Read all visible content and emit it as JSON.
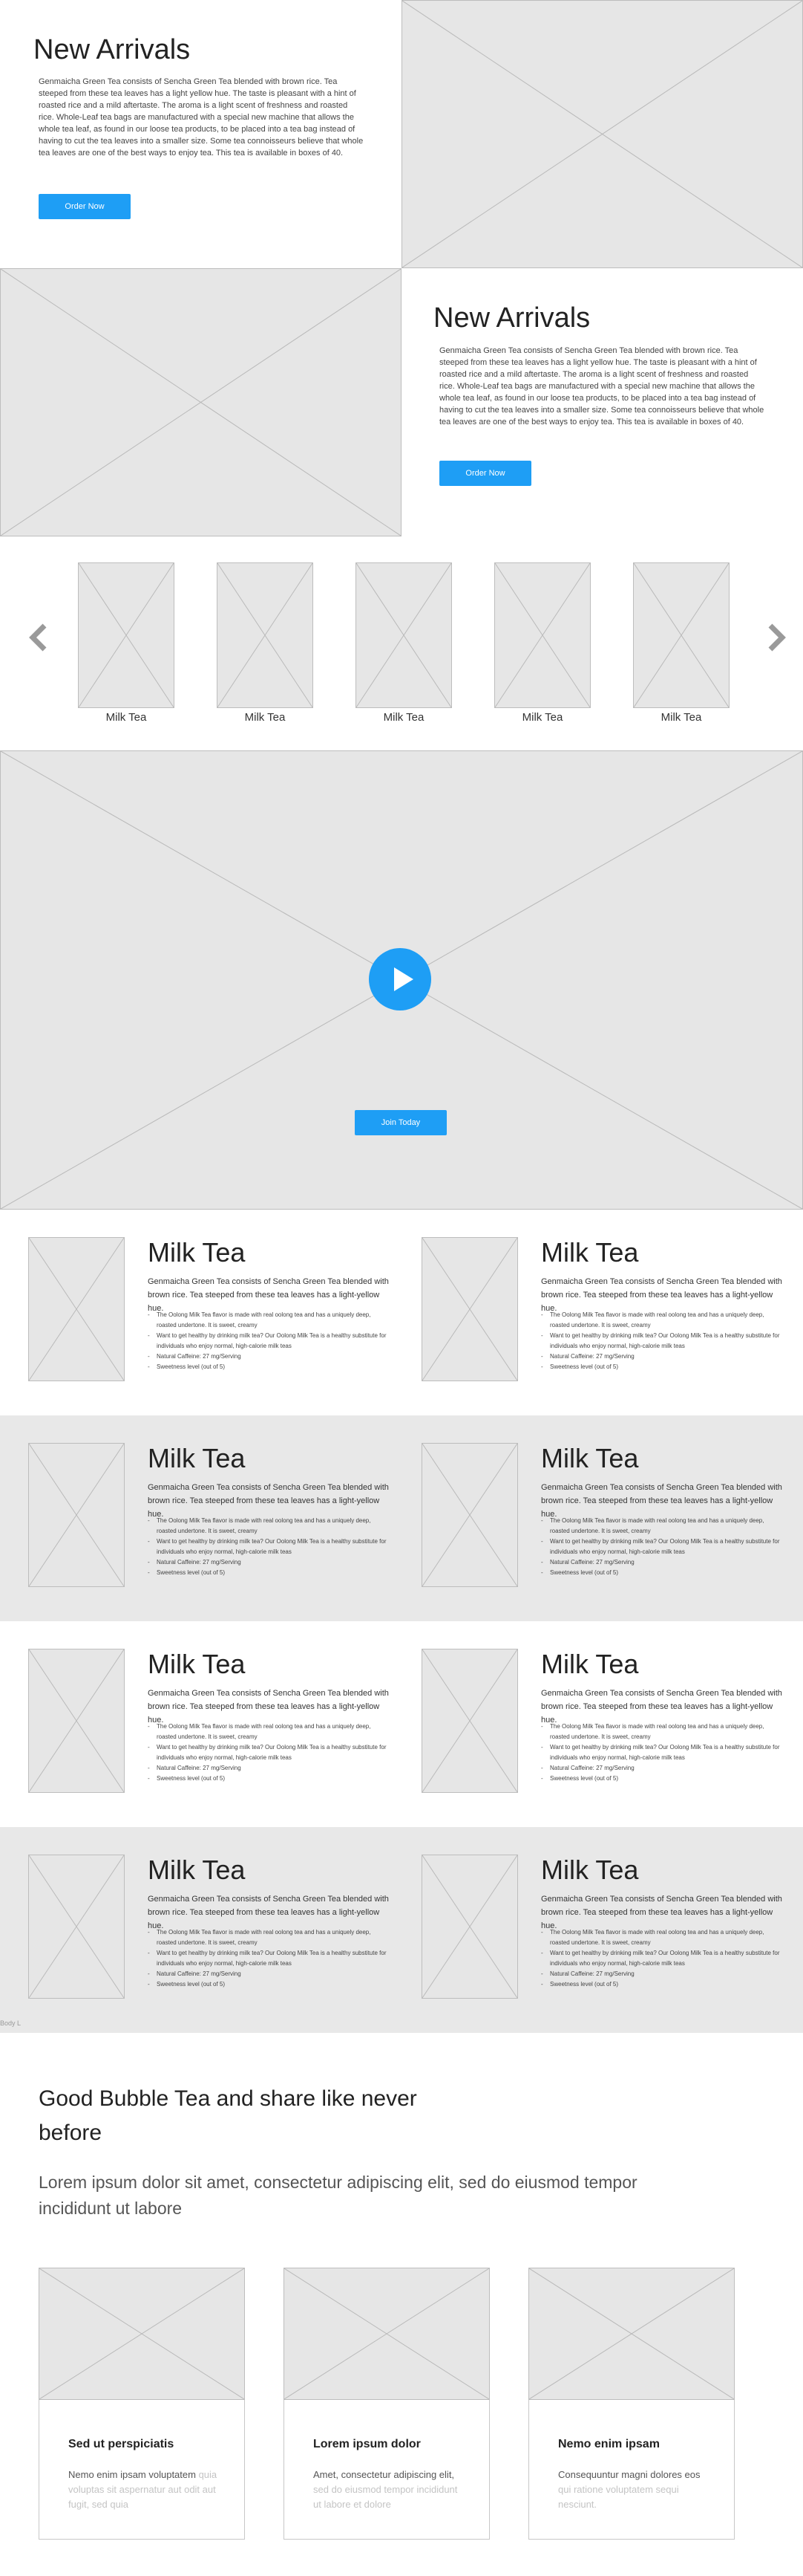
{
  "hero1": {
    "title": "New Arrivals",
    "text": "Genmaicha Green Tea  consists of Sencha Green Tea blended with brown rice. Tea steeped from these tea leaves has a light yellow hue. The taste is pleasant with a hint of roasted rice and a mild aftertaste. The aroma is a light scent of freshness and roasted rice. Whole-Leaf tea bags are manufactured with a special new machine that allows the whole tea leaf, as found in our loose tea products, to be placed into a tea bag instead of having to cut the tea leaves into a smaller size. Some tea connoisseurs believe that whole tea leaves are one of the best ways to enjoy tea. This tea is available in boxes of 40.",
    "button": "Order Now"
  },
  "hero2": {
    "title": "New Arrivals",
    "text": "Genmaicha Green Tea  consists of Sencha Green Tea blended with brown rice. Tea steeped from these tea leaves has a light yellow hue. The taste is pleasant with a hint of roasted rice and a mild aftertaste. The aroma is a light scent of freshness and roasted rice. Whole-Leaf tea bags are manufactured with a special new machine that allows the whole tea leaf, as found in our loose tea products, to be placed into a tea bag instead of having to cut the tea leaves into a smaller size. Some tea connoisseurs believe that whole tea leaves are one of the best ways to enjoy tea. This tea is available in boxes of 40.",
    "button": "Order Now"
  },
  "carousel": {
    "prev_icon": "chevron-left-icon",
    "next_icon": "chevron-right-icon",
    "items": [
      "Milk Tea",
      "Milk Tea",
      "Milk Tea",
      "Milk Tea",
      "Milk Tea"
    ]
  },
  "video": {
    "play_icon": "play-icon",
    "button": "Join Today"
  },
  "products": {
    "title": "Milk Tea",
    "intro": "Genmaicha Green Tea  consists of Sencha Green Tea blended with brown rice. Tea steeped from these tea leaves has a light-yellow hue.",
    "bullets": [
      "The Oolong Milk Tea flavor is made with real oolong tea and has a uniquely deep, roasted undertone. It is sweet, creamy",
      "Want to get healthy by drinking milk tea? Our Oolong Milk Tea is a healthy substitute for individuals who enjoy normal, high-calorie milk teas",
      "Natural Caffeine: 27 mg/Serving",
      "Sweetness level (out of 5)"
    ]
  },
  "small_label": "Body L",
  "cta": {
    "title": "Good Bubble Tea and share like never before",
    "subtitle": "Lorem ipsum dolor sit amet, consectetur adipiscing elit, sed do eiusmod tempor incididunt ut labore"
  },
  "cards": [
    {
      "title": "Sed ut perspiciatis",
      "lead": "Nemo enim ipsam voluptatem",
      "rest": " quia voluptas sit aspernatur aut odit aut fugit, sed quia"
    },
    {
      "title": "Lorem ipsum dolor",
      "lead": "Amet, consectetur adipiscing elit,",
      "rest": " sed do eiusmod tempor incididunt ut labore et dolore"
    },
    {
      "title": "Nemo enim ipsam",
      "lead": "Consequuntur magni dolores eos",
      "rest": " qui ratione voluptatem sequi nesciunt."
    }
  ],
  "colors": {
    "accent": "#1e9ef5",
    "placeholder": "#e6e6e6",
    "band": "#e8e8e8"
  }
}
